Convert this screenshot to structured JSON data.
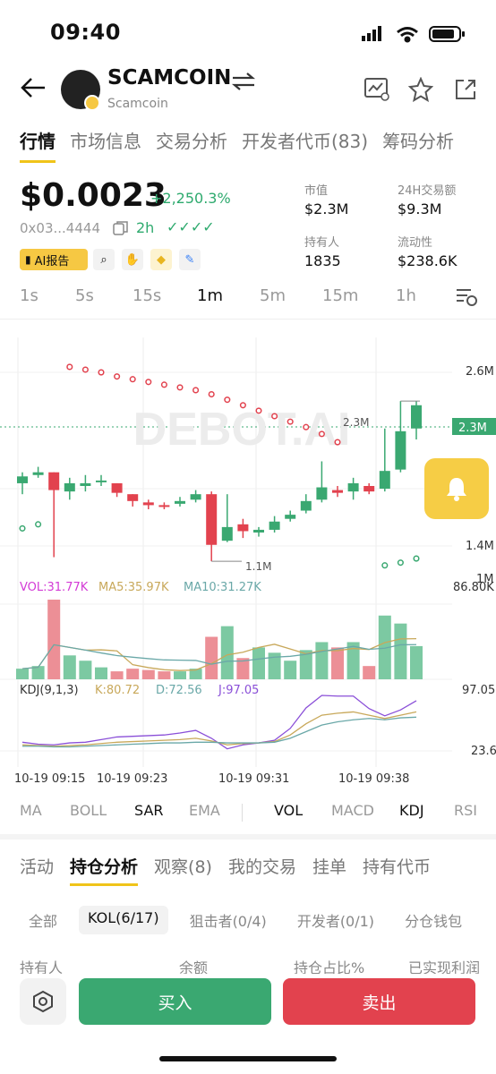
{
  "status": {
    "time": "09:40"
  },
  "header": {
    "title": "SCAMCOIN",
    "subtitle": "Scamcoin"
  },
  "top_tabs": [
    "行情",
    "市场信息",
    "交易分析",
    "开发者代币(83)",
    "筹码分析"
  ],
  "token": {
    "price": "$0.0023",
    "change": "+2,250.3%",
    "address": "0x03...4444",
    "age": "2h",
    "checks": "✓✓✓✓",
    "ai_report": "AI报告"
  },
  "stats": {
    "market_cap_label": "市值",
    "market_cap": "$2.3M",
    "vol24_label": "24H交易额",
    "vol24": "$9.3M",
    "holders_label": "持有人",
    "holders": "1835",
    "liquidity_label": "流动性",
    "liquidity": "$238.6K"
  },
  "timeframes": [
    "1s",
    "5s",
    "15s",
    "1m",
    "5m",
    "15m",
    "1h"
  ],
  "active_timeframe": "1m",
  "chart": {
    "watermark": "DEBOT.AI",
    "y_ticks": [
      "2.6M",
      "1.4M",
      "1M"
    ],
    "y_tick_hidden": "M",
    "price_tag": "2.3M",
    "high_label": "2.3M",
    "low_label": "1.1M",
    "vol_legend": "VOL:31.77K",
    "ma5_legend": "MA5:35.97K",
    "ma10_legend": "MA10:31.27K",
    "vol_max": "86.80K",
    "kdj_legend": "KDJ(9,1,3)",
    "k_legend": "K:80.72",
    "d_legend": "D:72.56",
    "j_legend": "J:97.05",
    "kdj_max": "97.05",
    "kdj_min": "23.6",
    "x_labels": [
      "10-19 09:15",
      "10-19 09:23",
      "10-19 09:31",
      "10-19 09:38"
    ]
  },
  "chart_data": {
    "type": "candlestick",
    "candles": [
      {
        "o": 1.7,
        "c": 1.75,
        "h": 1.78,
        "l": 1.62
      },
      {
        "o": 1.76,
        "c": 1.78,
        "h": 1.82,
        "l": 1.74
      },
      {
        "o": 1.78,
        "c": 1.65,
        "h": 1.78,
        "l": 1.16
      },
      {
        "o": 1.64,
        "c": 1.7,
        "h": 1.74,
        "l": 1.58
      },
      {
        "o": 1.68,
        "c": 1.7,
        "h": 1.76,
        "l": 1.64
      },
      {
        "o": 1.71,
        "c": 1.72,
        "h": 1.76,
        "l": 1.68
      },
      {
        "o": 1.7,
        "c": 1.63,
        "h": 1.7,
        "l": 1.6
      },
      {
        "o": 1.62,
        "c": 1.57,
        "h": 1.62,
        "l": 1.53
      },
      {
        "o": 1.56,
        "c": 1.54,
        "h": 1.58,
        "l": 1.51
      },
      {
        "o": 1.54,
        "c": 1.53,
        "h": 1.56,
        "l": 1.51
      },
      {
        "o": 1.55,
        "c": 1.57,
        "h": 1.6,
        "l": 1.53
      },
      {
        "o": 1.58,
        "c": 1.62,
        "h": 1.65,
        "l": 1.56
      },
      {
        "o": 1.62,
        "c": 1.25,
        "h": 1.64,
        "l": 1.13
      },
      {
        "o": 1.28,
        "c": 1.38,
        "h": 1.62,
        "l": 1.27
      },
      {
        "o": 1.4,
        "c": 1.35,
        "h": 1.44,
        "l": 1.3
      },
      {
        "o": 1.34,
        "c": 1.36,
        "h": 1.38,
        "l": 1.31
      },
      {
        "o": 1.36,
        "c": 1.42,
        "h": 1.46,
        "l": 1.34
      },
      {
        "o": 1.44,
        "c": 1.47,
        "h": 1.5,
        "l": 1.42
      },
      {
        "o": 1.5,
        "c": 1.57,
        "h": 1.62,
        "l": 1.48
      },
      {
        "o": 1.58,
        "c": 1.67,
        "h": 1.86,
        "l": 1.56
      },
      {
        "o": 1.65,
        "c": 1.63,
        "h": 1.68,
        "l": 1.6
      },
      {
        "o": 1.64,
        "c": 1.7,
        "h": 1.74,
        "l": 1.58
      },
      {
        "o": 1.68,
        "c": 1.64,
        "h": 1.7,
        "l": 1.62
      },
      {
        "o": 1.66,
        "c": 1.79,
        "h": 2.1,
        "l": 1.64
      },
      {
        "o": 1.8,
        "c": 2.08,
        "h": 2.3,
        "l": 1.78
      },
      {
        "o": 2.1,
        "c": 2.27,
        "h": 2.3,
        "l": 2.02
      }
    ],
    "sar": [
      {
        "i": 0,
        "v": 1.37
      },
      {
        "i": 1,
        "v": 1.4
      },
      {
        "i": 3,
        "v": 2.55
      },
      {
        "i": 4,
        "v": 2.53
      },
      {
        "i": 5,
        "v": 2.51
      },
      {
        "i": 6,
        "v": 2.48
      },
      {
        "i": 7,
        "v": 2.46
      },
      {
        "i": 8,
        "v": 2.44
      },
      {
        "i": 9,
        "v": 2.42
      },
      {
        "i": 10,
        "v": 2.4
      },
      {
        "i": 11,
        "v": 2.38
      },
      {
        "i": 12,
        "v": 2.35
      },
      {
        "i": 13,
        "v": 2.31
      },
      {
        "i": 14,
        "v": 2.27
      },
      {
        "i": 15,
        "v": 2.23
      },
      {
        "i": 16,
        "v": 2.19
      },
      {
        "i": 17,
        "v": 2.15
      },
      {
        "i": 18,
        "v": 2.11
      },
      {
        "i": 19,
        "v": 2.06
      },
      {
        "i": 20,
        "v": 2.0
      },
      {
        "i": 23,
        "v": 1.1
      },
      {
        "i": 24,
        "v": 1.12
      },
      {
        "i": 25,
        "v": 1.15
      }
    ],
    "volume": [
      8,
      10,
      60,
      18,
      14,
      9,
      6,
      8,
      7,
      6,
      6,
      8,
      32,
      40,
      16,
      24,
      20,
      14,
      22,
      28,
      24,
      28,
      10,
      48,
      42,
      25
    ],
    "kdj_k": [
      30,
      29,
      28,
      29,
      30,
      32,
      34,
      35,
      36,
      37,
      38,
      40,
      36,
      30,
      32,
      33,
      35,
      45,
      62,
      75,
      78,
      80,
      75,
      70,
      75,
      80
    ],
    "kdj_d": [
      28,
      28,
      27,
      27,
      28,
      29,
      30,
      31,
      32,
      33,
      33,
      34,
      34,
      33,
      33,
      33,
      34,
      40,
      50,
      60,
      65,
      68,
      70,
      68,
      71,
      72
    ],
    "kdj_j": [
      34,
      31,
      30,
      33,
      34,
      38,
      42,
      43,
      44,
      45,
      48,
      52,
      40,
      24,
      30,
      33,
      37,
      55,
      86,
      105,
      104,
      104,
      85,
      74,
      83,
      97
    ],
    "y_min": 1.0,
    "y_max": 2.7
  },
  "indicators": [
    "MA",
    "BOLL",
    "SAR",
    "EMA",
    "VOL",
    "MACD",
    "KDJ",
    "RSI"
  ],
  "active_indicators": [
    "SAR",
    "VOL",
    "KDJ"
  ],
  "tabs2": [
    "活动",
    "持仓分析",
    "观察(8)",
    "我的交易",
    "挂单",
    "持有代币"
  ],
  "filters": [
    "全部",
    "KOL(6/17)",
    "狙击者(0/4)",
    "开发者(0/1)",
    "分仓钱包"
  ],
  "columns": [
    "持有人",
    "余额",
    "持仓占比%",
    "已实现利润"
  ],
  "actions": {
    "buy": "买入",
    "sell": "卖出"
  },
  "colors": {
    "up": "#3aa871",
    "down": "#e2424e",
    "accent": "#f0c419"
  }
}
